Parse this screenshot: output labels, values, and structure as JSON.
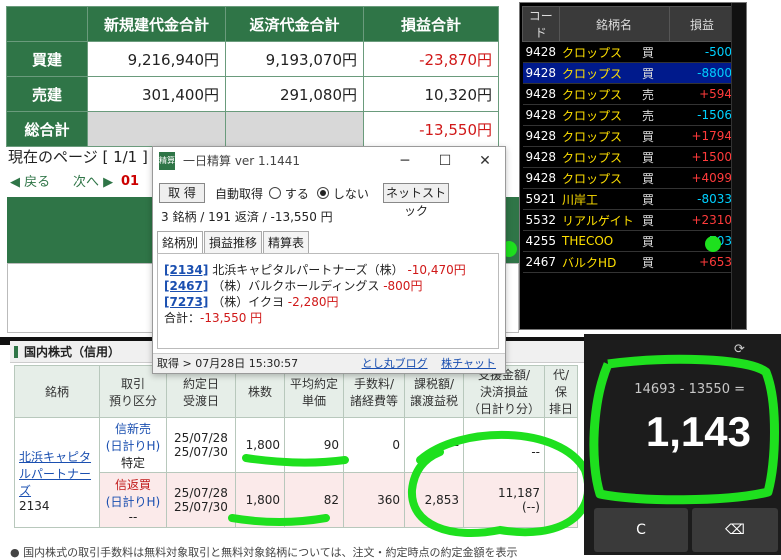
{
  "summary": {
    "headers": [
      "新規建代金合計",
      "返済代金合計",
      "損益合計"
    ],
    "rows": [
      {
        "label": "買建",
        "new": "9,216,940円",
        "ret": "9,193,070円",
        "pl": "-23,870円"
      },
      {
        "label": "売建",
        "new": "301,400円",
        "ret": "291,080円",
        "pl": "10,320円"
      },
      {
        "label": "総合計",
        "new": "",
        "ret": "",
        "pl": "-13,550円"
      }
    ]
  },
  "paging": {
    "label": "現在のページ [ 1/1 ]",
    "back": "◀ 戻る",
    "next": "次へ ▶",
    "page": "01"
  },
  "stock_list": {
    "headers": [
      "コード",
      "銘柄名",
      "",
      "損益"
    ],
    "rows": [
      {
        "code": "9428",
        "name": "クロップス",
        "side": "買",
        "pl": "-500",
        "sign": "neg"
      },
      {
        "code": "9428",
        "name": "クロップス",
        "side": "買",
        "pl": "-8800",
        "sign": "neg"
      },
      {
        "code": "9428",
        "name": "クロップス",
        "side": "売",
        "pl": "+594",
        "sign": "pos"
      },
      {
        "code": "9428",
        "name": "クロップス",
        "side": "売",
        "pl": "-1506",
        "sign": "neg"
      },
      {
        "code": "9428",
        "name": "クロップス",
        "side": "買",
        "pl": "+1794",
        "sign": "pos"
      },
      {
        "code": "9428",
        "name": "クロップス",
        "side": "買",
        "pl": "+1500",
        "sign": "pos"
      },
      {
        "code": "9428",
        "name": "クロップス",
        "side": "買",
        "pl": "+4099",
        "sign": "pos"
      },
      {
        "code": "5921",
        "name": "川岸工",
        "side": "買",
        "pl": "-8033",
        "sign": "neg"
      },
      {
        "code": "5532",
        "name": "リアルゲイト",
        "side": "買",
        "pl": "+2310",
        "sign": "pos"
      },
      {
        "code": "4255",
        "name": "THECOO",
        "side": "買",
        "pl": "-703",
        "sign": "neg"
      },
      {
        "code": "2467",
        "name": "バルクHD",
        "side": "買",
        "pl": "+653",
        "sign": "pos"
      }
    ]
  },
  "popup": {
    "title": "一日精算 ver 1.1441",
    "icon_text": "精算",
    "btn_get": "取 得",
    "auto_label": "自動取得",
    "opt_on": "する",
    "opt_off": "しない",
    "btn_net": "ネットストック",
    "summary_line": "3 銘柄 / 191 返済 / -13,550 円",
    "tabs": [
      "銘柄別",
      "損益推移",
      "精算表"
    ],
    "entries": [
      {
        "code": "[2134]",
        "name": "北浜キャピタルパートナーズ（株）",
        "pl": "-10,470円"
      },
      {
        "code": "[2467]",
        "name": "（株）バルクホールディングス",
        "pl": "-800円"
      },
      {
        "code": "[7273]",
        "name": "（株）イクヨ",
        "pl": "-2,280円"
      }
    ],
    "total_label": "合計：",
    "total_value": "-13,550 円",
    "status_time": "取得 > 07月28日 15:30:57",
    "status_link1": "とし丸ブログ",
    "status_link2": "株チャット"
  },
  "credit": {
    "section_title": "国内株式（信用）",
    "headers": [
      "銘柄",
      "取引\n預り区分",
      "約定日\n受渡日",
      "株数",
      "平均約定\n単価",
      "手数料/\n諸経費等",
      "課税額/\n譲渡益税",
      "支援金額/\n決済損益\n（日計り分）",
      "代/保\n排日"
    ],
    "row1": {
      "name": "北浜キャピタルパートナーズ",
      "code": "2134",
      "type": "信新売",
      "sub": "(日計りH)",
      "acct": "特定",
      "date1": "25/07/28",
      "date2": "25/07/30",
      "qty": "1,800",
      "price": "90",
      "fee": "0",
      "tax": "--",
      "amt": "--",
      "pl": "--"
    },
    "row2": {
      "type": "信返買",
      "sub": "(日計りH)",
      "acct": "--",
      "date1": "25/07/28",
      "date2": "25/07/30",
      "qty": "1,800",
      "price": "82",
      "fee": "360",
      "tax": "2,853",
      "amt": "11,187",
      "pl": "(--)"
    }
  },
  "notice": "● 国内株式の取引手数料は無料対象取引と無料対象銘柄については、注文・約定時点の約定金額を表示",
  "calculator": {
    "expression": "14693 - 13550 =",
    "result": "1,143",
    "key_c": "C",
    "key_back": "⌫",
    "hist_icon": "⟳"
  },
  "colors": {
    "header_green": "#2f7547",
    "negative": "#d01818",
    "annotation_green": "#1ee01e"
  }
}
